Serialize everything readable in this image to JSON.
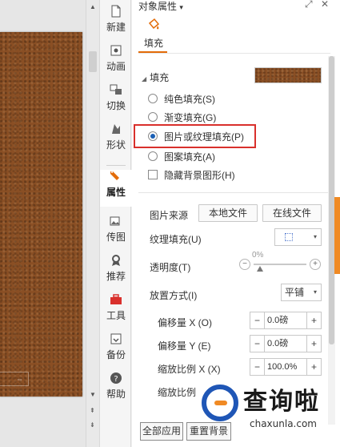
{
  "sidebar": {
    "items": [
      {
        "label": "新建",
        "icon": "new-doc-icon"
      },
      {
        "label": "动画",
        "icon": "animation-icon"
      },
      {
        "label": "切换",
        "icon": "transition-icon"
      },
      {
        "label": "形状",
        "icon": "shape-icon"
      },
      {
        "label": "属性",
        "icon": "properties-icon"
      },
      {
        "label": "传图",
        "icon": "upload-image-icon"
      },
      {
        "label": "推荐",
        "icon": "recommend-icon"
      },
      {
        "label": "工具",
        "icon": "toolbox-icon"
      },
      {
        "label": "备份",
        "icon": "backup-icon"
      },
      {
        "label": "帮助",
        "icon": "help-icon"
      }
    ],
    "active": "属性"
  },
  "panel": {
    "title": "对象属性",
    "title_caret": "▾",
    "tab_fill": "填充",
    "section_fill": "填充",
    "options": {
      "solid": "纯色填充(S)",
      "gradient": "渐变填充(G)",
      "picture_texture": "图片或纹理填充(P)",
      "pattern": "图案填充(A)",
      "hide_background": "隐藏背景图形(H)"
    },
    "selected_option": "picture_texture",
    "picture_source_label": "图片来源",
    "local_file_button": "本地文件",
    "online_file_button": "在线文件",
    "texture_fill_label": "纹理填充(U)",
    "transparency_label": "透明度(T)",
    "transparency_value": "0%",
    "placement_label": "放置方式(I)",
    "placement_value": "平铺",
    "offset_x_label": "偏移量 X (O)",
    "offset_x_value": "0.0磅",
    "offset_y_label": "偏移量 Y (E)",
    "offset_y_value": "0.0磅",
    "scale_x_label": "缩放比例 X (X)",
    "scale_x_value": "100.0%",
    "scale_y_label": "缩放比例",
    "apply_all_button": "全部应用",
    "reset_background_button": "重置背景"
  },
  "watermark": {
    "title": "查询啦",
    "url": "chaxunla.com"
  },
  "colors": {
    "texture": "#8a4f24",
    "accent": "#e36c09",
    "highlight_box": "#d9302c",
    "watermark_blue": "#1f56b6"
  }
}
